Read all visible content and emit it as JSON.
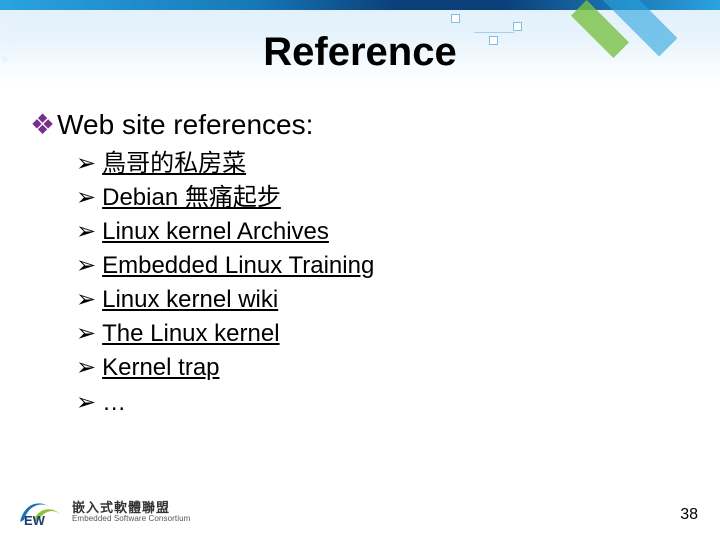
{
  "title": "Reference",
  "heading_text": "Web site references:",
  "bullet_glyph": "❖",
  "arrow_glyph": "➢",
  "items": [
    {
      "label": "鳥哥的私房菜",
      "link": true
    },
    {
      "label": "Debian 無痛起步",
      "link": true
    },
    {
      "label": "Linux kernel Archives",
      "link": true
    },
    {
      "label": "Embedded Linux Training",
      "link": true
    },
    {
      "label": "Linux kernel wiki",
      "link": true
    },
    {
      "label": "The Linux kernel",
      "link": true
    },
    {
      "label": "Kernel trap",
      "link": true
    },
    {
      "label": "…",
      "link": false
    }
  ],
  "logo": {
    "zh": "嵌入式軟體聯盟",
    "en": "Embedded Software Consortium"
  },
  "page_number": "38"
}
